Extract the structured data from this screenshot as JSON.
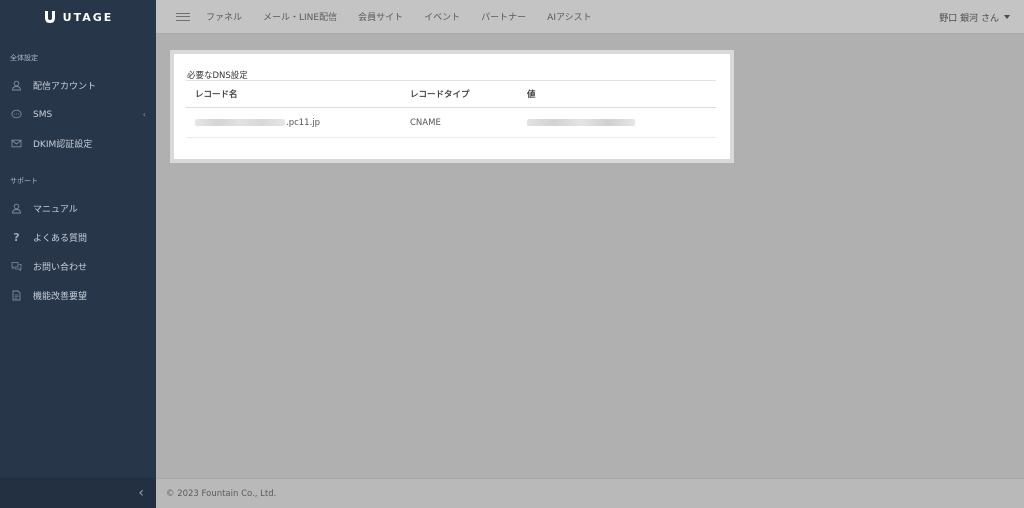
{
  "brand": {
    "name": "UTAGE"
  },
  "topnav": {
    "items": [
      "ファネル",
      "メール・LINE配信",
      "会員サイト",
      "イベント",
      "パートナー",
      "AIアシスト"
    ],
    "user": "野口 銀河 さん"
  },
  "sidebar": {
    "sections": [
      {
        "label": "全体設定",
        "items": [
          "配信アカウント",
          "SMS",
          "DKIM認証設定"
        ]
      },
      {
        "label": "サポート",
        "items": [
          "マニュアル",
          "よくある質問",
          "お問い合わせ",
          "機能改善要望"
        ]
      }
    ]
  },
  "card": {
    "title": "必要なDNS設定",
    "columns": [
      "レコード名",
      "レコードタイプ",
      "値"
    ],
    "rows": [
      {
        "name_suffix": ".pc11.jp",
        "type": "CNAME"
      }
    ]
  },
  "footer": {
    "copyright": "© 2023 Fountain Co., Ltd."
  },
  "icons": {
    "sidebar": [
      "user-icon",
      "sms-icon",
      "mail-icon",
      "user-icon",
      "question-icon",
      "chat-icon",
      "document-icon"
    ],
    "collapse": "chevron-left-icon"
  }
}
